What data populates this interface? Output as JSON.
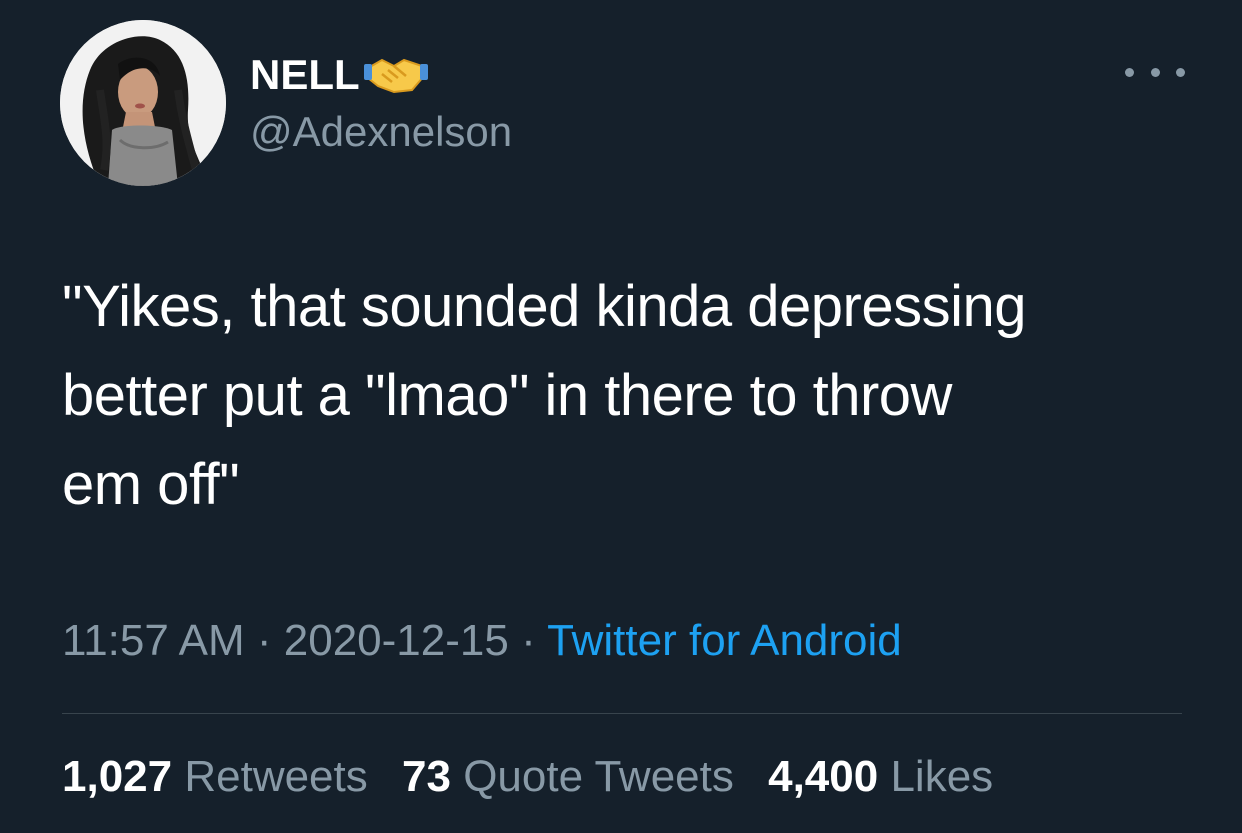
{
  "user": {
    "display_name": "NELL",
    "handle": "@Adexnelson",
    "badge_icon": "handshake-icon"
  },
  "tweet": {
    "text": "\"Yikes, that sounded kinda depressing\nbetter put a \"lmao\" in there to throw\nem off\"",
    "time": "11:57 AM",
    "separator": "·",
    "date": "2020-12-15",
    "source": "Twitter for Android"
  },
  "stats": {
    "retweets_count": "1,027",
    "retweets_label": "Retweets",
    "quote_count": "73",
    "quote_label": "Quote Tweets",
    "likes_count": "4,400",
    "likes_label": "Likes"
  },
  "colors": {
    "background": "#15202b",
    "secondary_text": "#8899a6",
    "accent": "#1da1f2",
    "divider": "#38444d"
  }
}
